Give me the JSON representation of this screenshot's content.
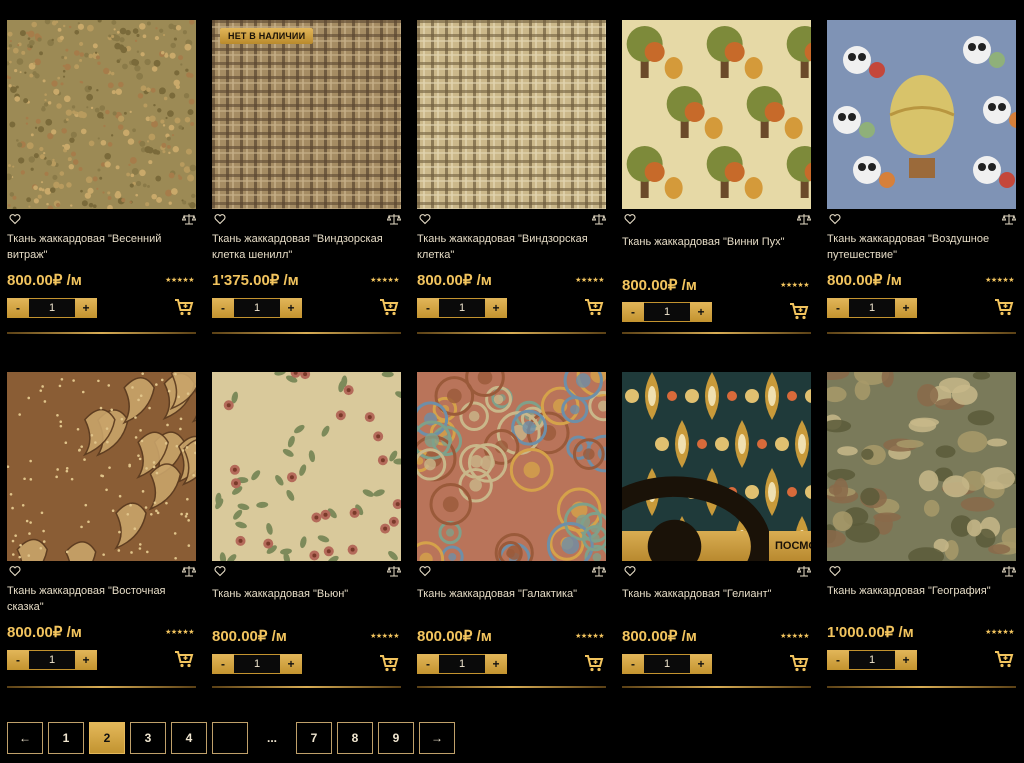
{
  "products": [
    {
      "title": "Ткань жаккардовая \"Весенний витраж\"",
      "price": "800.00₽ /м",
      "qty": "1",
      "rating_stars": "★★★★★",
      "badge": "",
      "pattern": "floral-small"
    },
    {
      "title": "Ткань жаккардовая \"Виндзорская клетка шенилл\"",
      "price": "1'375.00₽ /м",
      "qty": "1",
      "rating_stars": "★★★★★",
      "badge": "НЕТ В НАЛИЧИИ",
      "pattern": "plaid-brown"
    },
    {
      "title": "Ткань жаккардовая \"Виндзорская клетка\"",
      "price": "800.00₽ /м",
      "qty": "1",
      "rating_stars": "★★★★★",
      "badge": "",
      "pattern": "plaid-light"
    },
    {
      "title": "Ткань жаккардовая \"Винни Пух\"",
      "price": "800.00₽ /м",
      "qty": "1",
      "rating_stars": "★★★★★",
      "badge": "",
      "pattern": "pooh"
    },
    {
      "title": "Ткань жаккардовая \"Воздушное путешествие\"",
      "price": "800.00₽ /м",
      "qty": "1",
      "rating_stars": "★★★★★",
      "badge": "",
      "pattern": "balloon"
    },
    {
      "title": "Ткань жаккардовая \"Восточная сказка\"",
      "price": "800.00₽ /м",
      "qty": "1",
      "rating_stars": "★★★★★",
      "badge": "",
      "pattern": "paisley"
    },
    {
      "title": "Ткань жаккардовая \"Вьюн\"",
      "price": "800.00₽ /м",
      "qty": "1",
      "rating_stars": "★★★★★",
      "badge": "",
      "pattern": "vine"
    },
    {
      "title": "Ткань жаккардовая \"Галактика\"",
      "price": "800.00₽ /м",
      "qty": "1",
      "rating_stars": "★★★★★",
      "badge": "",
      "pattern": "circles"
    },
    {
      "title": "Ткань жаккардовая \"Гелиант\"",
      "price": "800.00₽ /м",
      "qty": "1",
      "rating_stars": "★★★★★",
      "badge": "",
      "pattern": "damask"
    },
    {
      "title": "Ткань жаккардовая \"География\"",
      "price": "1'000.00₽ /м",
      "qty": "1",
      "rating_stars": "★★★★★",
      "badge": "",
      "pattern": "map"
    }
  ],
  "view_button_label": "ПОСМОТРЕТЬ",
  "qty_minus": "-",
  "qty_plus": "+",
  "pagination": {
    "prev": "←",
    "pages": [
      "1",
      "2",
      "3",
      "4",
      "",
      "...",
      "7",
      "8",
      "9"
    ],
    "active": "2",
    "next": "→"
  },
  "colors": {
    "accent": "#f2c45e",
    "background": "#000000",
    "button": "#d9ad52"
  }
}
